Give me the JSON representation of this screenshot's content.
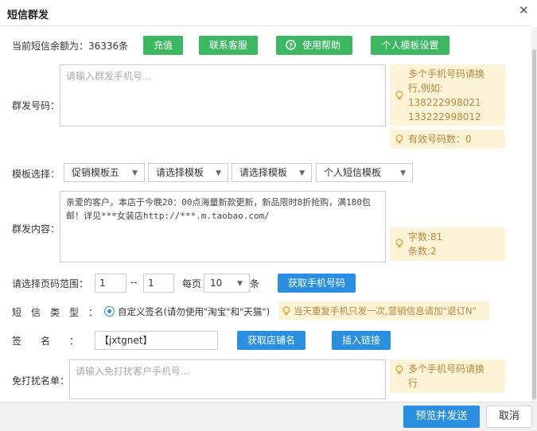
{
  "dialog": {
    "title": "短信群发",
    "close_glyph": "✕"
  },
  "balance": {
    "label": "当前短信余额为：36336条"
  },
  "top_buttons": {
    "recharge": "充值",
    "contact_service": "联系客服",
    "help": "使用帮助",
    "template_settings": "个人模板设置"
  },
  "recipients": {
    "label": "群发号码：",
    "placeholder": "请输入群发手机号...",
    "tip_lines": [
      "多个手机号码请换",
      "行,例如:",
      "138222998021",
      "133222998012"
    ],
    "valid_count": "有效号码数：0"
  },
  "template": {
    "label": "模板选择：",
    "selects": [
      "促销模板五",
      "请选择模板",
      "请选择模板",
      "个人短信模板"
    ]
  },
  "content": {
    "label": "群发内容：",
    "text": "亲爱的客户，本店于今晚20：00点海量新款更新，新品限时8折抢购，满180包邮！详见***女装店http://***.m.taobao.com/",
    "char_count": "字数:81",
    "msg_count": "条数:2"
  },
  "page_range": {
    "label": "请选择页码范围：",
    "from": "1",
    "separator": "--",
    "to": "1",
    "per_page_label": "每页",
    "per_page_value": "10",
    "unit": "条",
    "fetch_button": "获取手机号码"
  },
  "sms_type": {
    "label": "短　信　类　型　：",
    "option_label": "自定义签名(请勿使用\"淘宝\"和\"天猫\")",
    "tip": "当天重复手机只发一次,营销信息请加\"退订N\""
  },
  "signature": {
    "label": "签　　名　　：",
    "value": "【jxtgnet】",
    "get_shop_button": "获取店铺名",
    "insert_link_button": "插入链接"
  },
  "blocklist": {
    "label": "免打扰名单：",
    "placeholder": "请输入免打扰客户手机号...",
    "tip_lines": [
      "多个手机号码请换",
      "行"
    ]
  },
  "footer": {
    "preview_send": "预览并发送",
    "cancel": "取消"
  },
  "colors": {
    "green": "#3cb863",
    "blue": "#2a8fe0",
    "tip_bg": "#fdf3d7",
    "tip_text": "#b7893b"
  }
}
